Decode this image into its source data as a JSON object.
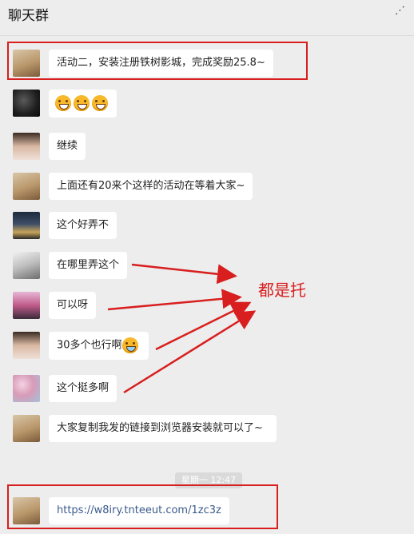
{
  "header": {
    "title": "聊天群",
    "more_icon": "more-icon"
  },
  "messages": [
    {
      "id": "m1",
      "avatar": "cat-avatar",
      "text": "活动二，安装注册铁树影城，完成奖励25.8~"
    },
    {
      "id": "m2",
      "avatar": "dark-avatar",
      "text": ""
    },
    {
      "id": "m3",
      "avatar": "girl-avatar",
      "text": "继续"
    },
    {
      "id": "m4",
      "avatar": "cat-avatar",
      "text": "上面还有20来个这样的活动在等着大家~"
    },
    {
      "id": "m5",
      "avatar": "street-avatar",
      "text": "这个好弄不"
    },
    {
      "id": "m6",
      "avatar": "sketch-avatar",
      "text": "在哪里弄这个"
    },
    {
      "id": "m7",
      "avatar": "pink-girl-avatar",
      "text": "可以呀"
    },
    {
      "id": "m8",
      "avatar": "girl-avatar",
      "text": "30多个也行啊"
    },
    {
      "id": "m9",
      "avatar": "flower-avatar",
      "text": "这个挺多啊"
    },
    {
      "id": "m10",
      "avatar": "cat-avatar",
      "text": "大家复制我发的链接到浏览器安装就可以了~"
    },
    {
      "id": "m11",
      "avatar": "cat-avatar",
      "text": "https://w8iry.tnteeut.com/1zc3z"
    }
  ],
  "timestamp": "星期一 12:47",
  "annotation": {
    "text": "都是托",
    "color": "#d81e1e"
  }
}
